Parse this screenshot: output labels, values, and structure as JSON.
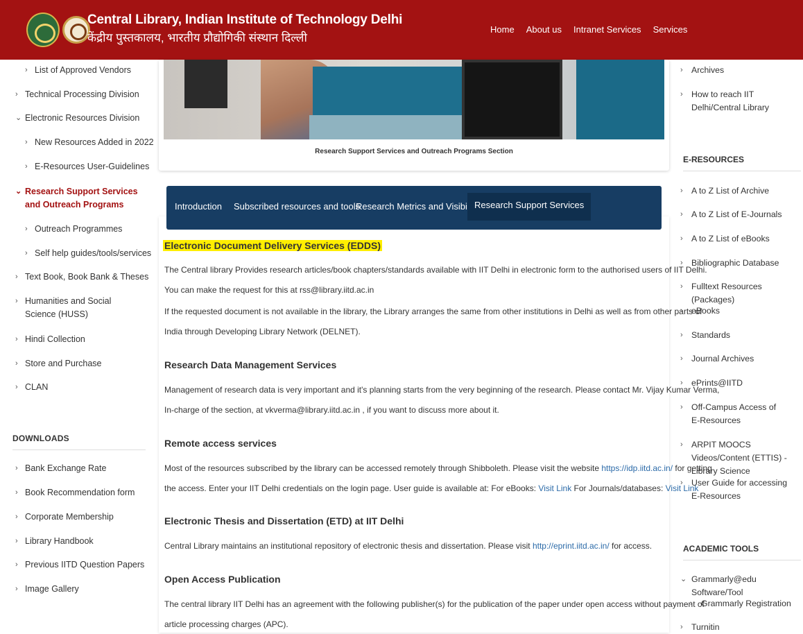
{
  "header": {
    "title_en": "Central Library, Indian Institute of Technology Delhi",
    "title_hi": "केंद्रीय पुस्तकालय, भारतीय प्रौद्योगिकी संस्थान दिल्ली",
    "nav": [
      "Home",
      "About us",
      "Intranet Services",
      "Services"
    ]
  },
  "left_nav": {
    "items": [
      "List of Approved Vendors",
      "Technical Processing Division",
      "Electronic Resources Division",
      "New Resources Added in 2022",
      "E-Resources User-Guidelines",
      "Research Support Services and Outreach Programs",
      "Outreach Programmes",
      "Self help guides/tools/services",
      "Text Book, Book Bank & Theses",
      "Humanities and Social Science (HUSS)",
      "Hindi Collection",
      "Store and Purchase",
      "CLAN"
    ],
    "downloads_heading": "DOWNLOADS",
    "downloads": [
      "Bank Exchange Rate",
      "Book Recommendation form",
      "Corporate Membership",
      "Library Handbook",
      "Previous IITD Question Papers",
      "Image Gallery"
    ]
  },
  "main": {
    "caption": "Research Support Services and Outreach Programs Section",
    "tabs": [
      "Introduction",
      "Subscribed resources and tools",
      "Research Metrics and Visibility",
      "Research Support Services"
    ],
    "edds": {
      "heading": "Electronic Document Delivery Services (EDDS)",
      "p1": "The Central library Provides research articles/book chapters/standards available with IIT Delhi in electronic form to the authorised users of IIT Delhi.",
      "p2": "You can make the request for this at rss@library.iitd.ac.in",
      "p3": "If the requested document is not available in the library, the Library arranges the same from other institutions in Delhi as well as from other parts of",
      "p4": "India through Developing Library Network (DELNET)."
    },
    "rdm": {
      "heading": "Research Data Management Services",
      "p1": "Management of research data is very important and it's planning starts from the very beginning of the research. Please contact Mr. Vijay Kumar Verma,",
      "p2": "In-charge of the section, at vkverma@library.iitd.ac.in , if you want to discuss more about it."
    },
    "remote": {
      "heading": "Remote access services",
      "p1_a": "Most of the resources subscribed by the library can be accessed remotely through Shibboleth. Please visit the website ",
      "p1_link": "https://idp.iitd.ac.in/",
      "p1_b": " for getting",
      "p2_a": "the access. Enter your IIT Delhi credentials on the login page. User guide is available at: For eBooks: ",
      "p2_link1": "Visit Link",
      "p2_b": " For Journals/databases: ",
      "p2_link2": "Visit Link"
    },
    "etd": {
      "heading": "Electronic Thesis and Dissertation (ETD) at IIT Delhi",
      "p1_a": "Central Library maintains an institutional repository of electronic thesis and dissertation. Please visit ",
      "p1_link": "http://eprint.iitd.ac.in/",
      "p1_b": " for access."
    },
    "oap": {
      "heading": "Open Access Publication",
      "p1": "The central library IIT Delhi has an agreement with the following publisher(s) for the publication of the paper under open access without payment of",
      "p2": "article processing charges (APC)."
    }
  },
  "right_nav": {
    "top_items": [
      "Archives",
      "How to reach IIT Delhi/Central Library"
    ],
    "eresources_heading": "E-RESOURCES",
    "eresources": [
      "A to Z List of Archive",
      "A to Z List of E-Journals",
      "A to Z List of eBooks",
      "Bibliographic Database",
      "Fulltext Resources (Packages)",
      "eBooks",
      "Standards",
      "Journal Archives",
      "ePrints@IITD",
      "Off-Campus Access of E-Resources",
      "ARPIT MOOCS Videos/Content (ETTIS) - Library Science",
      "User Guide for accessing E-Resources"
    ],
    "academic_heading": "ACADEMIC TOOLS",
    "academic": [
      "Grammarly@edu Software/Tool",
      "Grammarly Registration",
      "Turnitin"
    ]
  },
  "icons": {
    "chevron_right": "chevron-right-icon",
    "chevron_down": "chevron-down-icon"
  },
  "colors": {
    "header_bg": "#a31212",
    "tabs_bg": "#173d63",
    "link": "#2b6aa8",
    "highlight": "#ffee00"
  }
}
